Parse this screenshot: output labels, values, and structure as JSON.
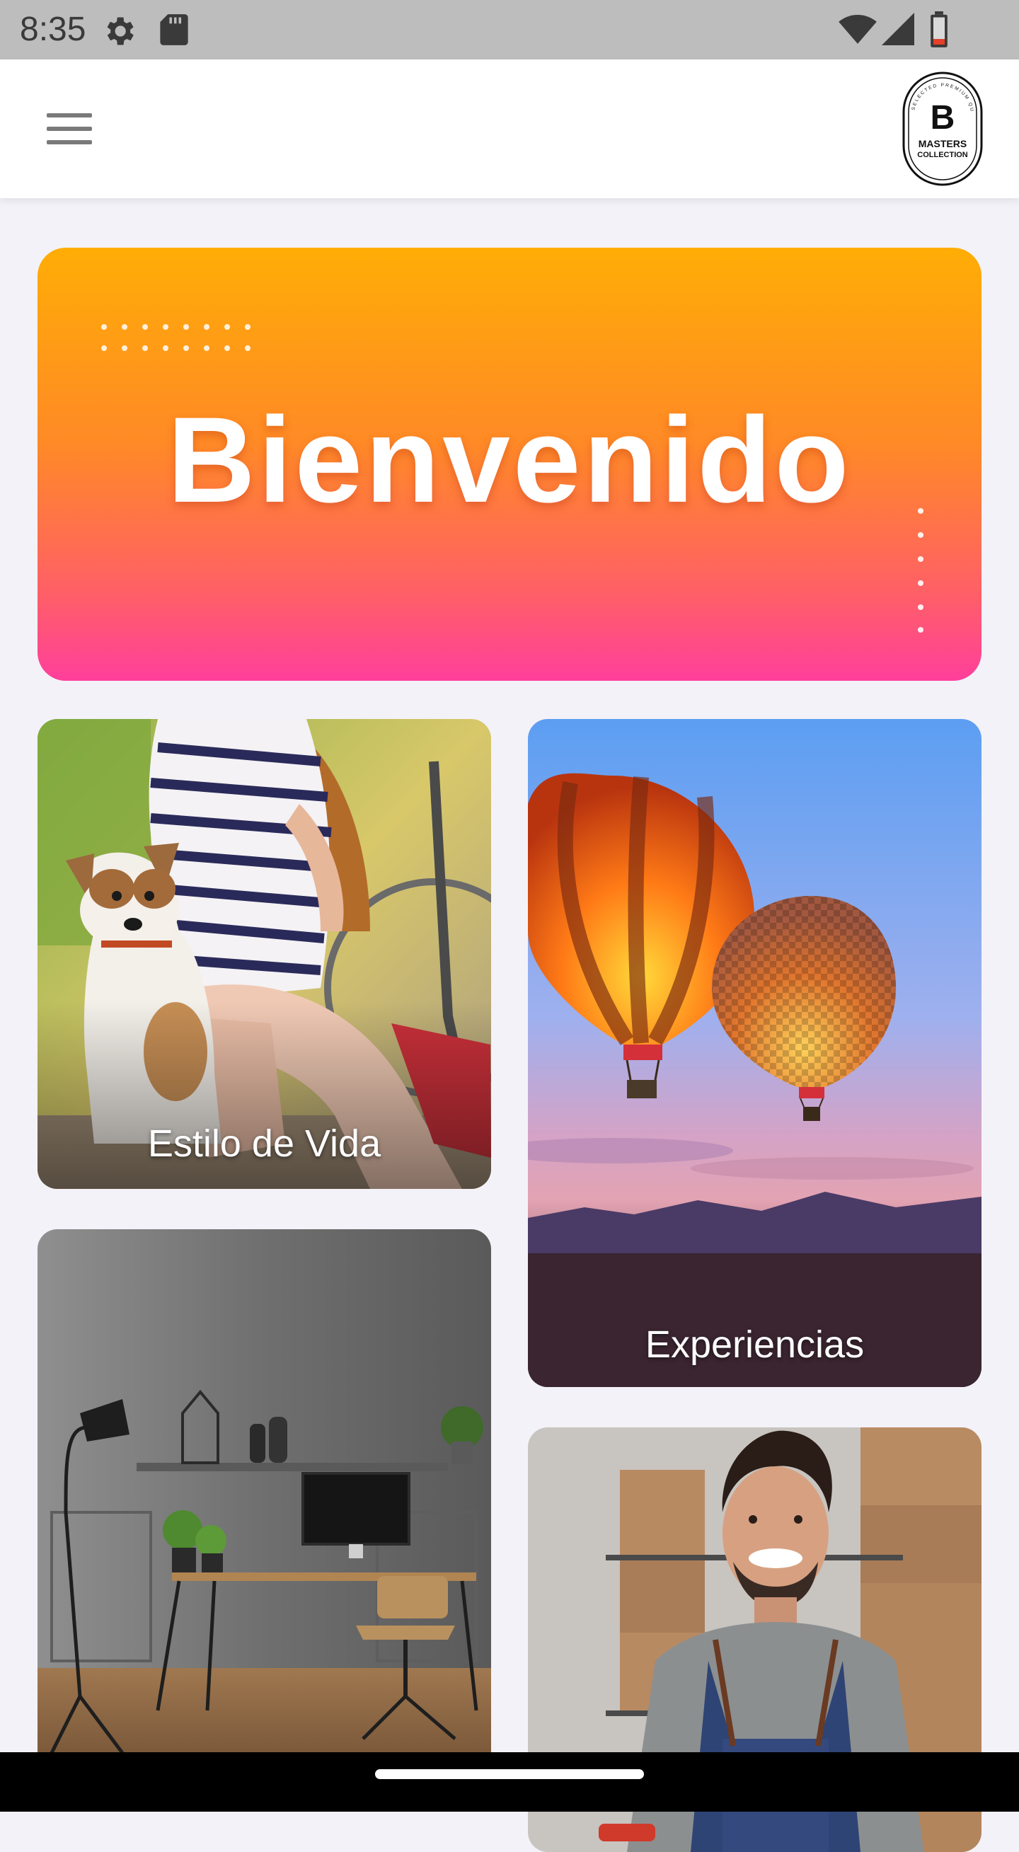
{
  "status_bar": {
    "time": "8:35",
    "icons": [
      "settings-icon",
      "sd-card-icon",
      "wifi-icon",
      "cell-signal-icon",
      "battery-icon"
    ]
  },
  "app_bar": {
    "menu_icon": "hamburger-menu-icon",
    "logo": {
      "letter": "B",
      "line1": "MASTERS",
      "line2": "COLLECTION",
      "ring_text": "SELECTED PREMIUM QUALITY"
    }
  },
  "banner": {
    "title": "Bienvenido",
    "gradient": [
      "#ffad06",
      "#ff3f9c"
    ]
  },
  "categories": [
    {
      "label": "Estilo de Vida",
      "image": "woman-with-dog-and-bicycle"
    },
    {
      "label": "Experiencias",
      "image": "hot-air-balloons-at-sunset"
    },
    {
      "label": "",
      "image": "home-office-desk"
    },
    {
      "label": "",
      "image": "smiling-shop-owner-with-boxes"
    }
  ],
  "colors": {
    "background": "#f3f2f8",
    "status_bar": "#bdbdbd",
    "app_bar": "#ffffff",
    "nav_bar": "#000000"
  }
}
